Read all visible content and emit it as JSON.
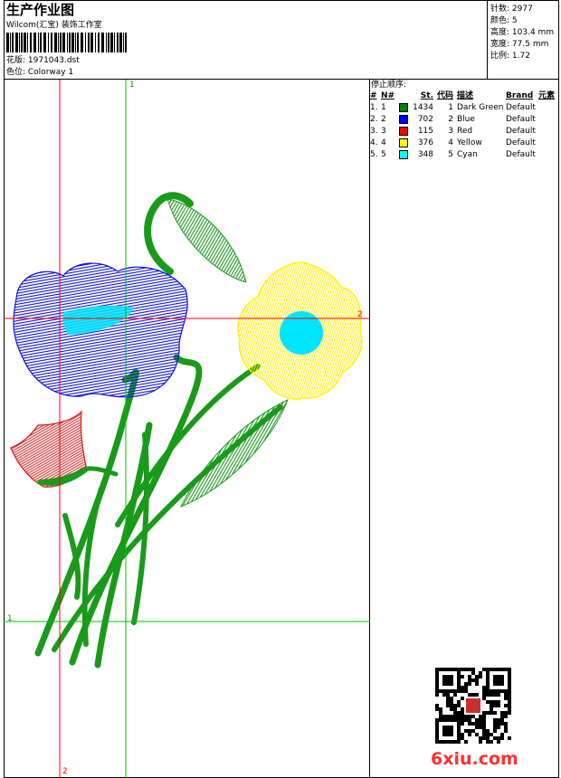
{
  "header": {
    "title": "生产作业图",
    "company": "Wilcom(汇宝) 装饰工作室",
    "design": "花版: 1971043.dst",
    "colorway": "色位: Colorway 1"
  },
  "stats": [
    {
      "label": "针数:",
      "value": "2977"
    },
    {
      "label": "颜色:",
      "value": "5"
    },
    {
      "label": "高度:",
      "value": "103.4 mm"
    },
    {
      "label": "宽度:",
      "value": "77.5 mm"
    },
    {
      "label": "比例:",
      "value": "1.72"
    }
  ],
  "stop_sequence": {
    "title": "停止顺序:",
    "headers": [
      "#",
      "N#",
      "St.",
      "代码",
      "描述",
      "Brand",
      "元素"
    ],
    "rows": [
      {
        "idx": "1.",
        "n": "1",
        "st": "1434",
        "code": "1",
        "desc": "Dark Green",
        "brand": "Default",
        "color": "#008000"
      },
      {
        "idx": "2.",
        "n": "2",
        "st": "702",
        "code": "2",
        "desc": "Blue",
        "brand": "Default",
        "color": "#0000ff"
      },
      {
        "idx": "3.",
        "n": "3",
        "st": "115",
        "code": "3",
        "desc": "Red",
        "brand": "Default",
        "color": "#ff0000"
      },
      {
        "idx": "4.",
        "n": "4",
        "st": "376",
        "code": "4",
        "desc": "Yellow",
        "brand": "Default",
        "color": "#ffff00"
      },
      {
        "idx": "5.",
        "n": "5",
        "st": "348",
        "code": "5",
        "desc": "Cyan",
        "brand": "Default",
        "color": "#00ffff"
      }
    ]
  },
  "guides": {
    "green_1": "1",
    "green_2": "1",
    "red_1": "2",
    "red_2": "2"
  },
  "watermark": "6xiu.com",
  "colors": {
    "guide_red": "#ff0000",
    "guide_green": "#00c000",
    "stem": "#1a9a1a",
    "petal_blue": "#1010e0",
    "petal_yellow": "#ffee00",
    "center_cyan": "#00e5ff",
    "petal_red": "#d81818",
    "watermark": "#ff3030"
  }
}
